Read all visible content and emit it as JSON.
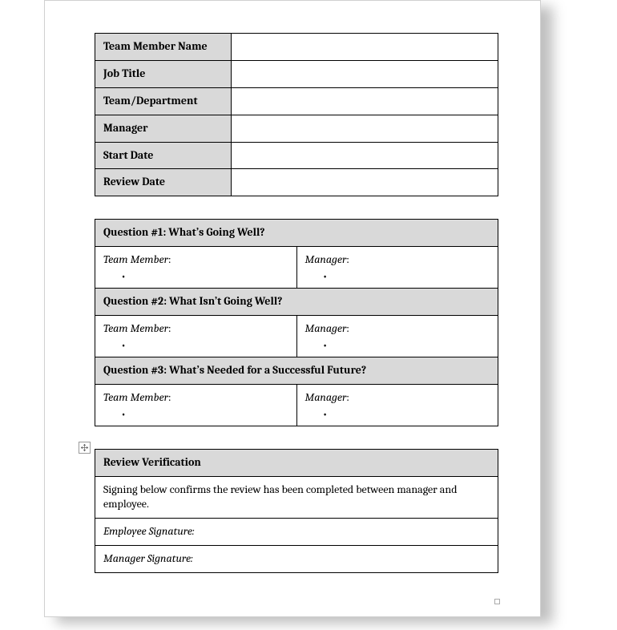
{
  "info_table": {
    "rows": [
      {
        "label": "Team Member Name",
        "value": ""
      },
      {
        "label": "Job Title",
        "value": ""
      },
      {
        "label": "Team/Department",
        "value": ""
      },
      {
        "label": "Manager",
        "value": ""
      },
      {
        "label": "Start Date",
        "value": ""
      },
      {
        "label": "Review Date",
        "value": ""
      }
    ]
  },
  "questions": {
    "team_member_label": "Team Member",
    "manager_label": "Manager",
    "items": [
      {
        "title": "Question #1: What’s Going Well?"
      },
      {
        "title": "Question #2: What Isn’t Going Well?"
      },
      {
        "title": "Question #3: What’s Needed for a Successful Future?"
      }
    ]
  },
  "verification": {
    "title": "Review Verification",
    "instruction": "Signing below confirms the review has been completed between manager and employee.",
    "employee_sig_label": "Employee Signature:",
    "manager_sig_label": "Manager Signature:"
  },
  "glyphs": {
    "bullet": "•",
    "colon": ":"
  }
}
